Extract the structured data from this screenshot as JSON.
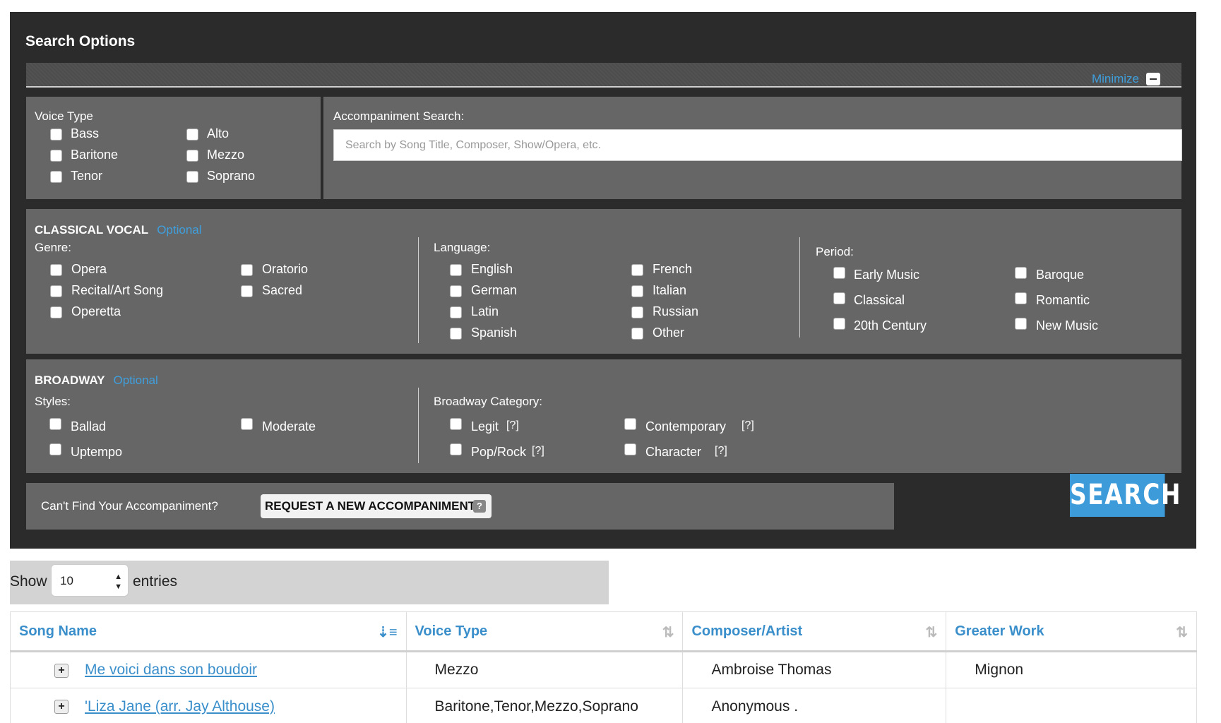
{
  "panel": {
    "title": "Search Options",
    "minimize_label": "Minimize"
  },
  "voice_type": {
    "title": "Voice Type",
    "options": [
      "Bass",
      "Baritone",
      "Tenor",
      "Alto",
      "Mezzo",
      "Soprano"
    ]
  },
  "accompaniment_search": {
    "label": "Accompaniment Search:",
    "placeholder": "Search by Song Title, Composer, Show/Opera, etc."
  },
  "classical": {
    "title": "CLASSICAL VOCAL",
    "optional": "Optional",
    "genre_label": "Genre:",
    "genres": [
      "Opera",
      "Recital/Art Song",
      "Operetta",
      "Oratorio",
      "Sacred"
    ],
    "language_label": "Language:",
    "languages": [
      "English",
      "German",
      "Latin",
      "Spanish",
      "French",
      "Italian",
      "Russian",
      "Other"
    ],
    "period_label": "Period:",
    "periods": [
      "Early Music",
      "Classical",
      "20th Century",
      "Baroque",
      "Romantic",
      "New Music"
    ]
  },
  "broadway": {
    "title": "BROADWAY",
    "optional": "Optional",
    "styles_label": "Styles:",
    "styles": [
      "Ballad",
      "Uptempo",
      "Moderate"
    ],
    "category_label": "Broadway Category:",
    "categories": [
      "Legit",
      "Pop/Rock",
      "Contemporary",
      "Character"
    ],
    "help": "[?]"
  },
  "request": {
    "prompt": "Can't Find Your Accompaniment?",
    "button": "REQUEST A NEW ACCOMPANIMENT",
    "help": "?"
  },
  "search_button": "SEARCH",
  "entries": {
    "show": "Show",
    "value": "10",
    "suffix": "entries"
  },
  "table": {
    "columns": [
      "Song Name",
      "Voice Type",
      "Composer/Artist",
      "Greater Work"
    ],
    "rows": [
      {
        "song": " Me voici dans son boudoir",
        "voice": "Mezzo",
        "composer": "Ambroise Thomas",
        "work": "Mignon"
      },
      {
        "song": "'Liza Jane (arr. Jay Althouse)",
        "voice": "Baritone,Tenor,Mezzo,Soprano",
        "composer": "Anonymous .",
        "work": ""
      }
    ]
  }
}
